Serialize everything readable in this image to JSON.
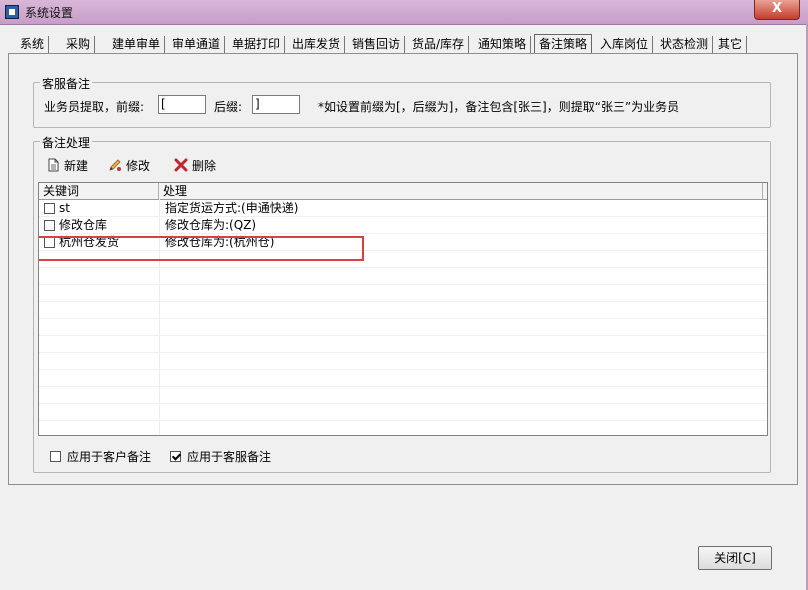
{
  "window": {
    "title": "系统设置",
    "close_glyph": "X"
  },
  "tabs": [
    {
      "label": "系统"
    },
    {
      "label": "采购"
    },
    {
      "label": "建单审单"
    },
    {
      "label": "审单通道"
    },
    {
      "label": "单据打印"
    },
    {
      "label": "出库发货"
    },
    {
      "label": "销售回访"
    },
    {
      "label": "货品/库存"
    },
    {
      "label": "通知策略"
    },
    {
      "label": "备注策略",
      "active": true
    },
    {
      "label": "入库岗位"
    },
    {
      "label": "状态检测"
    },
    {
      "label": "其它"
    }
  ],
  "service_note": {
    "title": "客服备注",
    "label_extract": "业务员提取，前缀:",
    "prefix_value": "[",
    "label_suffix": "后缀:",
    "suffix_value": "]",
    "hint": "*如设置前缀为[，后缀为]，备注包含[张三]，则提取“张三”为业务员"
  },
  "note_handling": {
    "title": "备注处理",
    "toolbar": {
      "new_label": "新建",
      "edit_label": "修改",
      "delete_label": "删除"
    },
    "columns": [
      "关键词",
      "处理"
    ],
    "rows": [
      {
        "keyword": "st",
        "action": "指定货运方式:(申通快递)",
        "checked": false
      },
      {
        "keyword": "修改仓库",
        "action": "修改仓库为:(QZ)",
        "checked": false
      },
      {
        "keyword": "杭州仓发货",
        "action": "修改仓库为:(杭州仓)",
        "checked": false
      }
    ],
    "apply_customer_label": "应用于客户备注",
    "apply_customer_checked": false,
    "apply_service_label": "应用于客服备注",
    "apply_service_checked": true
  },
  "footer": {
    "close_label": "关闭[C]"
  },
  "colors": {
    "title_bar": "#c79dc8",
    "close_button": "#c63b2b",
    "highlight": "#d94040"
  }
}
